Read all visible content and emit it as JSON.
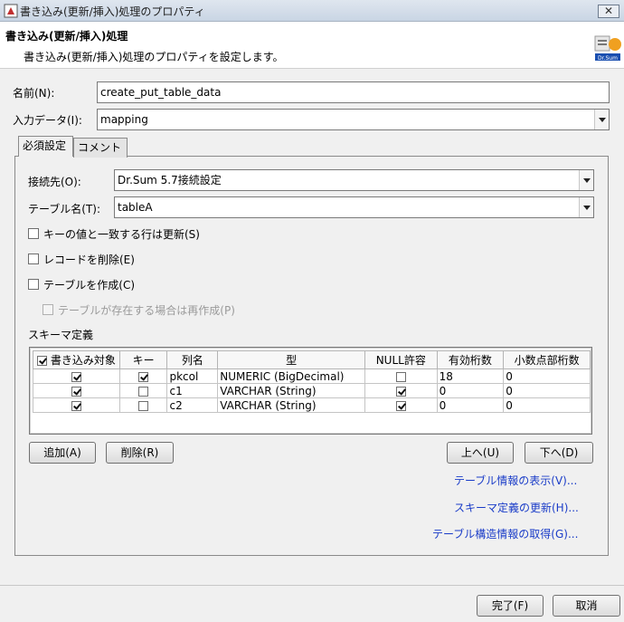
{
  "window": {
    "title": "書き込み(更新/挿入)処理のプロパティ"
  },
  "header": {
    "title": "書き込み(更新/挿入)処理",
    "description": "書き込み(更新/挿入)処理のプロパティを設定します。",
    "logo_text": "Dr.Sum"
  },
  "form": {
    "name_label": "名前(N):",
    "name_value": "create_put_table_data",
    "input_data_label": "入力データ(I):",
    "input_data_value": "mapping"
  },
  "tabs": [
    {
      "label": "必須設定",
      "active": true
    },
    {
      "label": "コメント",
      "active": false
    }
  ],
  "required": {
    "connection_label": "接続先(O):",
    "connection_value": "Dr.Sum 5.7接続設定",
    "table_name_label": "テーブル名(T):",
    "table_name_value": "tableA",
    "options": [
      {
        "label": "キーの値と一致する行は更新(S)",
        "checked": false,
        "enabled": true
      },
      {
        "label": "レコードを削除(E)",
        "checked": false,
        "enabled": true
      },
      {
        "label": "テーブルを作成(C)",
        "checked": false,
        "enabled": true
      },
      {
        "label": "テーブルが存在する場合は再作成(P)",
        "checked": false,
        "enabled": false
      }
    ],
    "schema_label": "スキーマ定義",
    "schema_table": {
      "columns": [
        "書き込み対象",
        "キー",
        "列名",
        "型",
        "NULL許容",
        "有効桁数",
        "小数点部桁数"
      ],
      "header_checked": true,
      "rows": [
        {
          "write": true,
          "key": true,
          "name": "pkcol",
          "type": "NUMERIC (BigDecimal)",
          "nullable": false,
          "precision": "18",
          "scale": "0"
        },
        {
          "write": true,
          "key": false,
          "name": "c1",
          "type": "VARCHAR (String)",
          "nullable": true,
          "precision": "0",
          "scale": "0"
        },
        {
          "write": true,
          "key": false,
          "name": "c2",
          "type": "VARCHAR (String)",
          "nullable": true,
          "precision": "0",
          "scale": "0"
        }
      ]
    },
    "buttons": {
      "add": "追加(A)",
      "delete": "削除(R)",
      "up": "上へ(U)",
      "down": "下へ(D)"
    },
    "links": {
      "show_table_info": "テーブル情報の表示(V)...",
      "update_schema": "スキーマ定義の更新(H)...",
      "get_table_structure": "テーブル構造情報の取得(G)..."
    }
  },
  "footer": {
    "finish": "完了(F)",
    "cancel": "取消"
  }
}
